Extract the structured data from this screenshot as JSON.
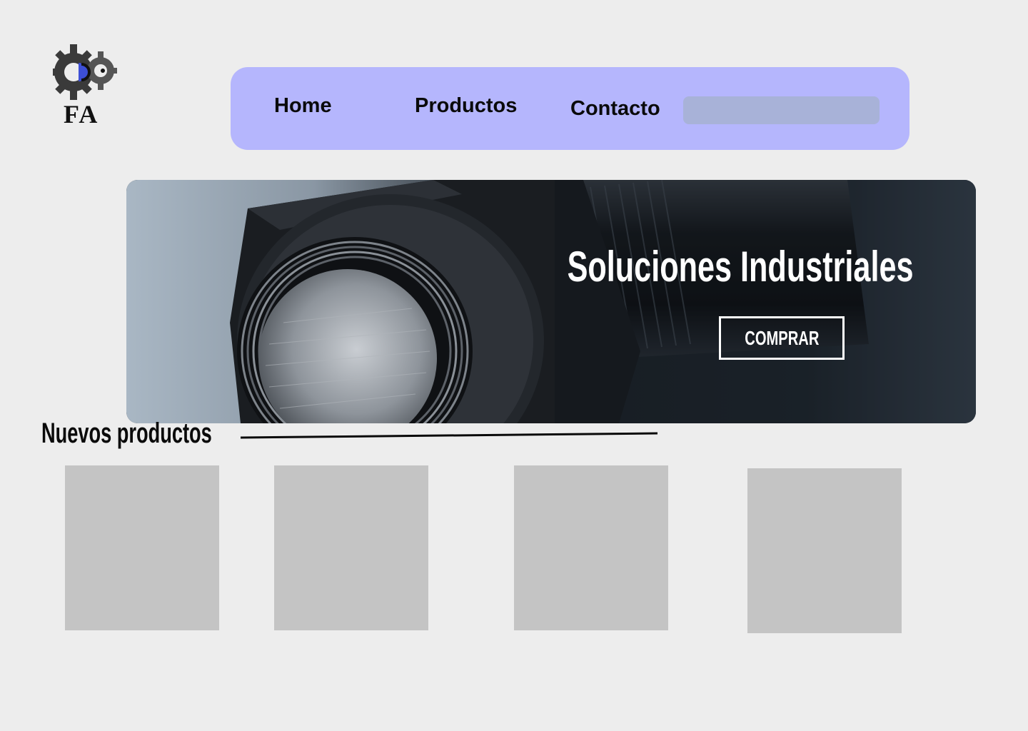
{
  "logo": {
    "text": "FA",
    "icon": "gear-icon"
  },
  "nav": {
    "items": [
      {
        "label": "Home"
      },
      {
        "label": "Productos"
      },
      {
        "label": "Contacto"
      }
    ],
    "search": {
      "placeholder": "",
      "value": ""
    }
  },
  "hero": {
    "title": "Soluciones Industriales",
    "button_label": "COMPRAR",
    "image": "bolt-nut-photo"
  },
  "section": {
    "title": "Nuevos productos"
  },
  "products": [
    {
      "image": "product-placeholder"
    },
    {
      "image": "product-placeholder"
    },
    {
      "image": "product-placeholder"
    },
    {
      "image": "product-placeholder"
    }
  ],
  "colors": {
    "background": "#ededed",
    "navbar": "#b5b6fd",
    "search_field": "#a8b2d8",
    "card_placeholder": "#c4c4c4",
    "logo_accent": "#3d4fd6"
  }
}
